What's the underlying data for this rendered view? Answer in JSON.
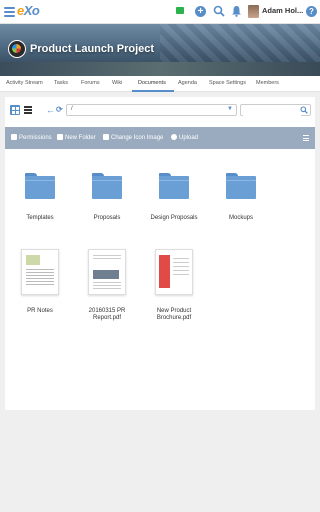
{
  "topbar": {
    "logo_e": "e",
    "logo_xo": "Xo",
    "user_name": "Adam Hol...",
    "help_label": "?",
    "plus_label": "+"
  },
  "space": {
    "title": "Product Launch Project"
  },
  "tabs": [
    {
      "label": "Activity Stream"
    },
    {
      "label": "Tasks"
    },
    {
      "label": "Forums"
    },
    {
      "label": "Wiki"
    },
    {
      "label": "Documents",
      "active": true
    },
    {
      "label": "Agenda"
    },
    {
      "label": "Space Settings"
    },
    {
      "label": "Members"
    }
  ],
  "documents": {
    "back_label": "←",
    "refresh_label": "⟳",
    "path": "/",
    "search_placeholder": "",
    "actions": {
      "permissions": "Permissions",
      "new_folder": "New Folder",
      "change_icon": "Change Icon Image",
      "upload": "Upload"
    },
    "folders": [
      {
        "name": "Templates"
      },
      {
        "name": "Proposals"
      },
      {
        "name": "Design Proposals"
      },
      {
        "name": "Mockups"
      }
    ],
    "files": [
      {
        "name": "PR Notes"
      },
      {
        "name": "20160315 PR Report.pdf"
      },
      {
        "name": "New Product Brochure.pdf"
      }
    ]
  },
  "colors": {
    "accent": "#578dc9",
    "action_bar": "#9aabbf",
    "folder": "#6a9fd6",
    "logo_orange": "#f6a01a"
  }
}
